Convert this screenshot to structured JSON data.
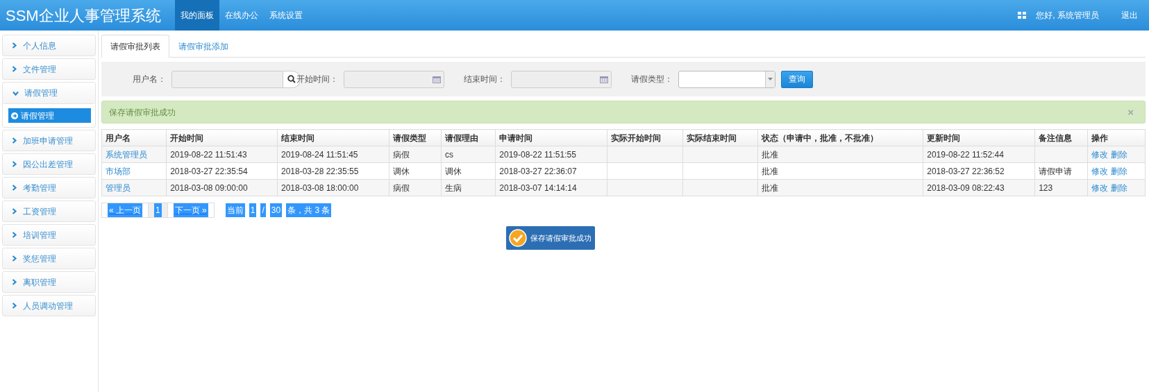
{
  "navbar": {
    "brand": "SSM企业人事管理系统",
    "items": [
      {
        "label": "我的面板",
        "selected": true
      },
      {
        "label": "在线办公",
        "selected": false
      },
      {
        "label": "系统设置",
        "selected": false
      }
    ],
    "greeting": "您好, 系统管理员",
    "logout": "退出"
  },
  "sidebar": {
    "items": [
      {
        "label": "个人信息",
        "expanded": false
      },
      {
        "label": "文件管理",
        "expanded": false
      },
      {
        "label": "请假管理",
        "expanded": true,
        "children": [
          {
            "label": "请假管理",
            "selected": true
          }
        ]
      },
      {
        "label": "加班申请管理",
        "expanded": false
      },
      {
        "label": "因公出差管理",
        "expanded": false
      },
      {
        "label": "考勤管理",
        "expanded": false
      },
      {
        "label": "工资管理",
        "expanded": false
      },
      {
        "label": "培训管理",
        "expanded": false
      },
      {
        "label": "奖惩管理",
        "expanded": false
      },
      {
        "label": "离职管理",
        "expanded": false
      },
      {
        "label": "人员调动管理",
        "expanded": false
      }
    ]
  },
  "tabs": [
    {
      "label": "请假审批列表",
      "selected": true
    },
    {
      "label": "请假审批添加",
      "selected": false
    }
  ],
  "filters": [
    {
      "kind": "search",
      "label": "用户名："
    },
    {
      "kind": "date",
      "label": "开始时间："
    },
    {
      "kind": "date",
      "label": "结束时间："
    },
    {
      "kind": "select",
      "label": "请假类型："
    }
  ],
  "query_button": "查询",
  "alert": "保存请假审批成功",
  "alert_close": "×",
  "table": {
    "columns": [
      "用户名",
      "开始时间",
      "结束时间",
      "请假类型",
      "请假理由",
      "申请时间",
      "实际开始时间",
      "实际结束时间",
      "状态（申请中，批准，不批准）",
      "更新时间",
      "备注信息",
      "操作"
    ],
    "rows": [
      {
        "cells": [
          "系统管理员",
          "2019-08-22 11:51:43",
          "2019-08-24 11:51:45",
          "病假",
          "cs",
          "2019-08-22 11:51:55",
          "",
          "",
          "批准",
          "2019-08-22 11:52:44",
          ""
        ],
        "actions": [
          "修改",
          "删除"
        ]
      },
      {
        "cells": [
          "市场部",
          "2018-03-27 22:35:54",
          "2018-03-28 22:35:55",
          "调休",
          "调休",
          "2018-03-27 22:36:07",
          "",
          "",
          "批准",
          "2018-03-27 22:36:52",
          "请假申请"
        ],
        "actions": [
          "修改",
          "删除"
        ]
      },
      {
        "cells": [
          "管理员",
          "2018-03-08 09:00:00",
          "2018-03-08 18:00:00",
          "病假",
          "生病",
          "2018-03-07 14:14:14",
          "",
          "",
          "批准",
          "2018-03-09 08:22:43",
          "123"
        ],
        "actions": [
          "修改",
          "删除"
        ]
      }
    ]
  },
  "pagination": {
    "prev": "« 上一页",
    "page": "1",
    "next": "下一页 »",
    "info": [
      "当前",
      "1",
      "/",
      "30",
      "条，共 3 条"
    ]
  },
  "toast": "保存请假审批成功"
}
